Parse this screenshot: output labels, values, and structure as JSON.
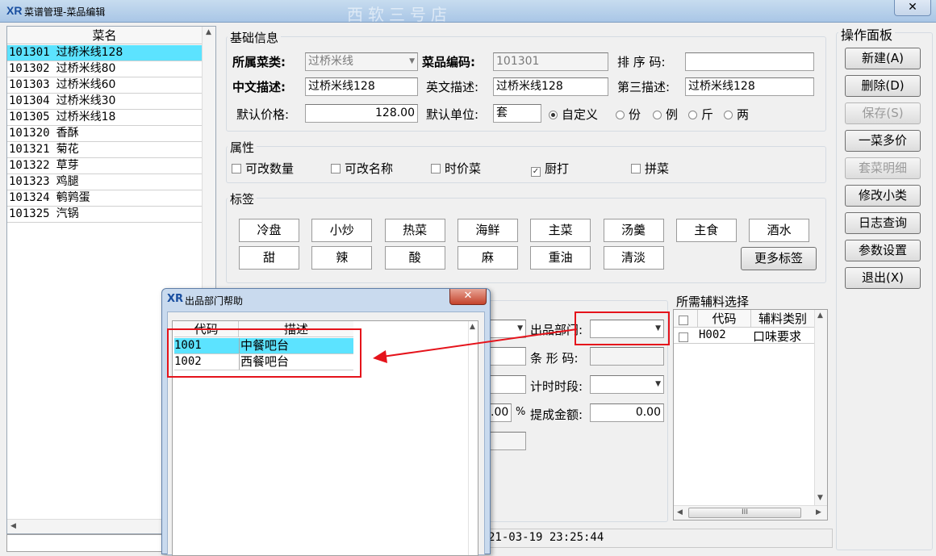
{
  "window": {
    "title": "菜谱管理-菜品编辑",
    "logo": "XR",
    "close": "✕",
    "brand_watermark": "西软三号店"
  },
  "list": {
    "header": "菜名",
    "rows": [
      {
        "code": "101301",
        "name": "过桥米线128",
        "selected": true
      },
      {
        "code": "101302",
        "name": "过桥米线80"
      },
      {
        "code": "101303",
        "name": "过桥米线60"
      },
      {
        "code": "101304",
        "name": "过桥米线30"
      },
      {
        "code": "101305",
        "name": "过桥米线18"
      },
      {
        "code": "101320",
        "name": "香酥"
      },
      {
        "code": "101321",
        "name": "菊花"
      },
      {
        "code": "101322",
        "name": "草芽"
      },
      {
        "code": "101323",
        "name": "鸡腿"
      },
      {
        "code": "101324",
        "name": "鹌鹑蛋"
      },
      {
        "code": "101325",
        "name": "汽锅"
      }
    ]
  },
  "basic": {
    "title": "基础信息",
    "category_label": "所属菜类:",
    "category_value": "过桥米线",
    "code_label": "菜品编码:",
    "code_value": "101301",
    "sort_label": "排 序 码:",
    "sort_value": "",
    "cn_label": "中文描述:",
    "cn_value": "过桥米线128",
    "en_label": "英文描述:",
    "en_value": "过桥米线128",
    "third_label": "第三描述:",
    "third_value": "过桥米线128",
    "price_label": "默认价格:",
    "price_value": "128.00",
    "unit_label": "默认单位:",
    "unit_value": "套",
    "unit_options": [
      {
        "label": "自定义",
        "checked": true
      },
      {
        "label": "份"
      },
      {
        "label": "例"
      },
      {
        "label": "斤"
      },
      {
        "label": "两"
      }
    ]
  },
  "attrs": {
    "title": "属性",
    "items": [
      {
        "label": "可改数量",
        "checked": false
      },
      {
        "label": "可改名称",
        "checked": false
      },
      {
        "label": "时价菜",
        "checked": false
      },
      {
        "label": "厨打",
        "checked": true
      },
      {
        "label": "拼菜",
        "checked": false
      }
    ]
  },
  "tags": {
    "title": "标签",
    "row1": [
      "冷盘",
      "小炒",
      "热菜",
      "海鲜",
      "主菜",
      "汤羹",
      "主食",
      "酒水"
    ],
    "row2": [
      "甜",
      "辣",
      "酸",
      "麻",
      "重油",
      "清淡"
    ],
    "more": "更多标签"
  },
  "detail": {
    "dept_label": "出品部门:",
    "dept_value": "",
    "barcode_label": "条 形 码:",
    "barcode_value": "",
    "timing_label": "计时时段:",
    "timing_value": "",
    "pct_value": ".00",
    "pct_sign": "%",
    "commission_label": "提成金额:",
    "commission_value": "0.00",
    "timestamp": "21-03-19 23:25:44"
  },
  "sides": {
    "title": "所需辅料选择",
    "col_code": "代码",
    "col_type": "辅料类别",
    "rows": [
      {
        "code": "H002",
        "type": "口味要求",
        "checked": false
      }
    ],
    "hscroll_grip": "III"
  },
  "panel": {
    "title": "操作面板",
    "buttons": [
      {
        "label": "新建(A)",
        "enabled": true
      },
      {
        "label": "删除(D)",
        "enabled": true
      },
      {
        "label": "保存(S)",
        "enabled": false
      },
      {
        "label": "一菜多价",
        "enabled": true
      },
      {
        "label": "套菜明细",
        "enabled": false
      },
      {
        "label": "修改小类",
        "enabled": true
      },
      {
        "label": "日志查询",
        "enabled": true
      },
      {
        "label": "参数设置",
        "enabled": true
      },
      {
        "label": "退出(X)",
        "enabled": true
      }
    ]
  },
  "popup": {
    "title": "出品部门帮助",
    "logo": "XR",
    "close": "✕",
    "col_code": "代码",
    "col_desc": "描述",
    "rows": [
      {
        "code": "1001",
        "desc": "中餐吧台",
        "selected": true
      },
      {
        "code": "1002",
        "desc": "西餐吧台"
      }
    ]
  },
  "colors": {
    "selection": "#5ce3ff",
    "annotation": "#e5131b",
    "titlebar": "#b9d1ea"
  }
}
